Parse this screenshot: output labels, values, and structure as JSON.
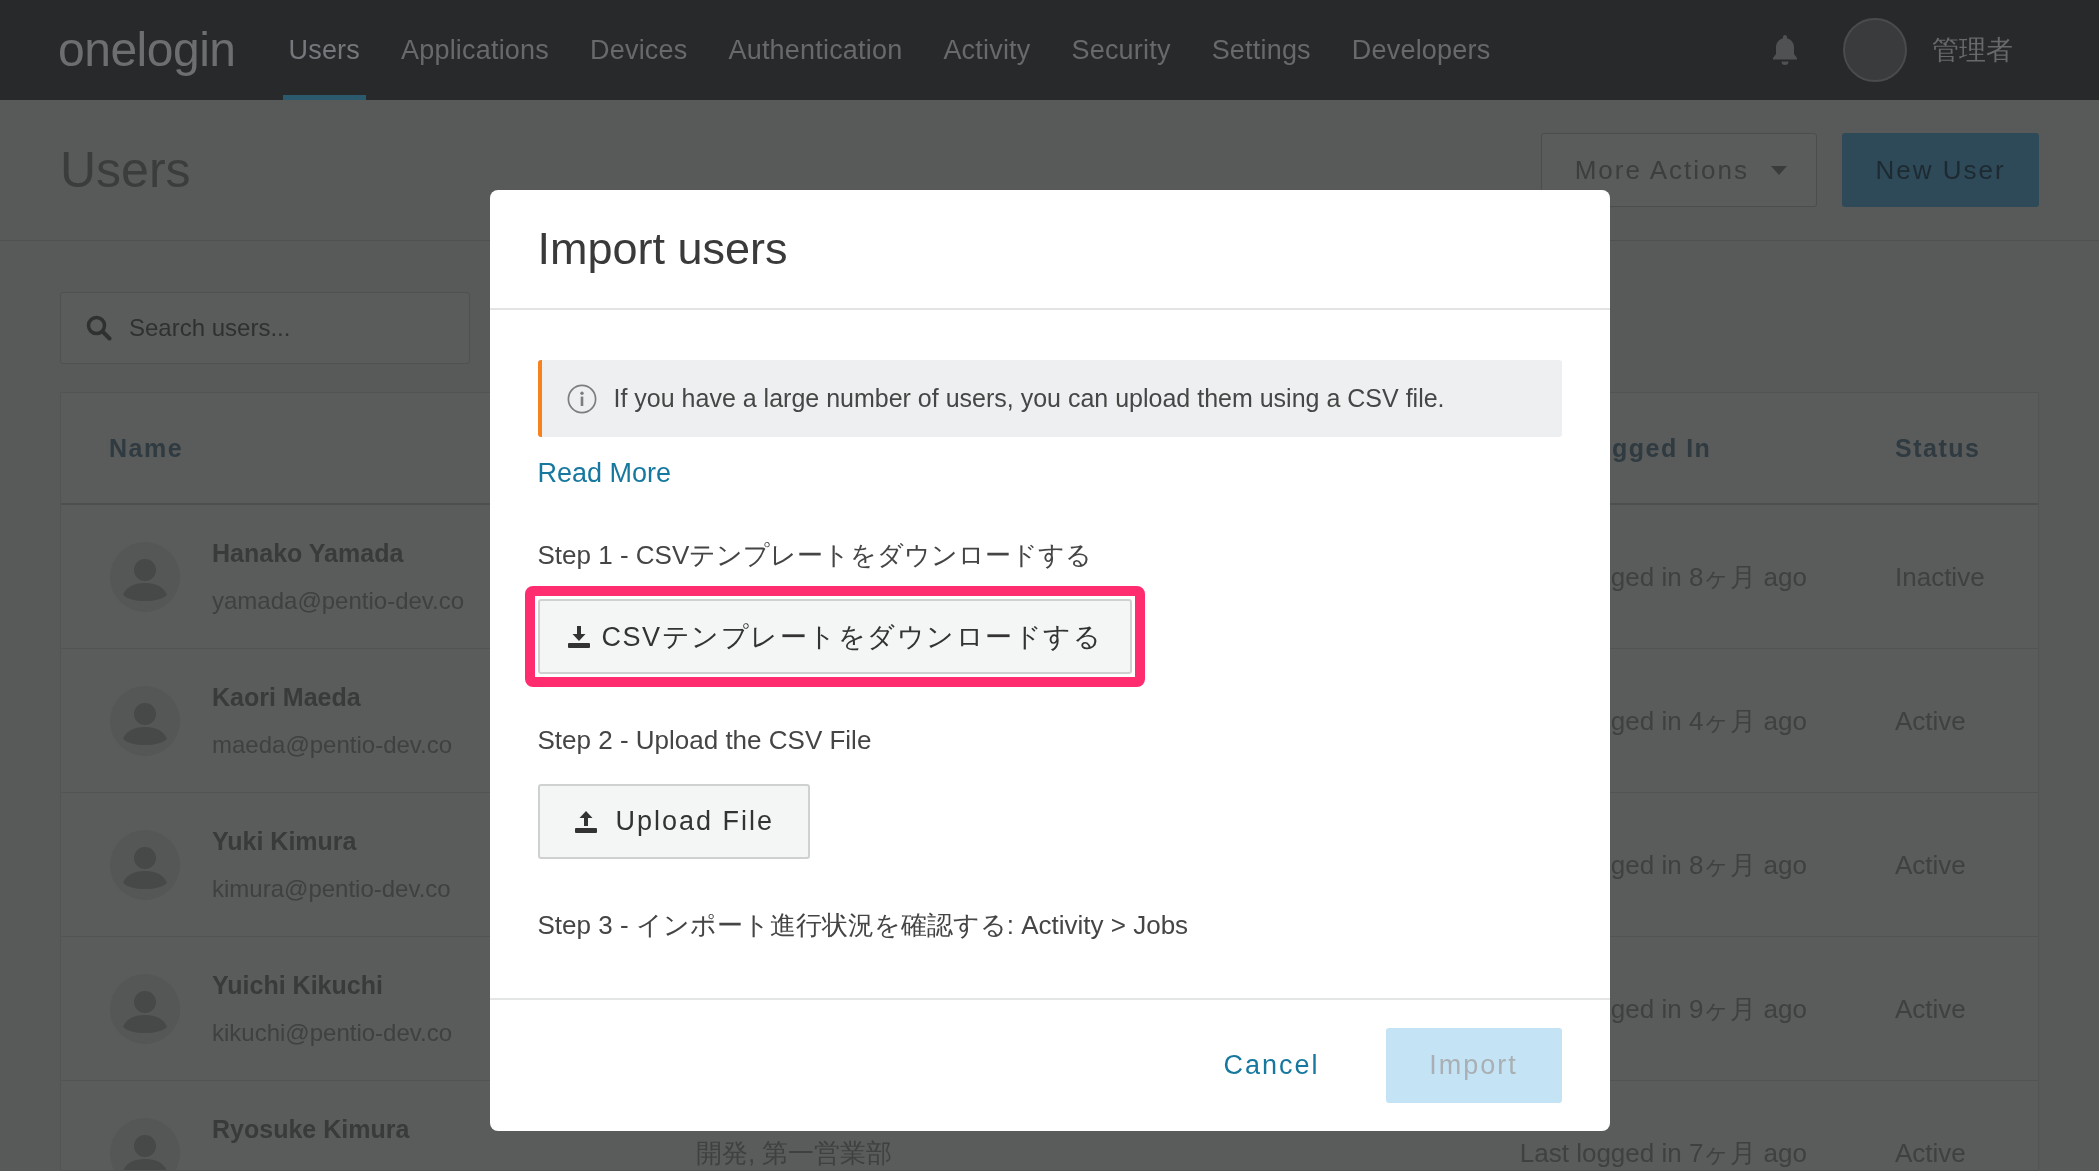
{
  "nav": {
    "logo": "onelogin",
    "items": [
      {
        "label": "Users",
        "selected": true
      },
      {
        "label": "Applications",
        "selected": false
      },
      {
        "label": "Devices",
        "selected": false
      },
      {
        "label": "Authentication",
        "selected": false
      },
      {
        "label": "Activity",
        "selected": false
      },
      {
        "label": "Security",
        "selected": false
      },
      {
        "label": "Settings",
        "selected": false
      },
      {
        "label": "Developers",
        "selected": false
      }
    ],
    "account": {
      "name": "管理者"
    }
  },
  "header": {
    "title": "Users",
    "buttons": [
      {
        "label": "More Actions",
        "kind": "dropdown"
      },
      {
        "label": "New User",
        "kind": "primary"
      }
    ]
  },
  "search": {
    "placeholder": "Search users..."
  },
  "table": {
    "columns": [
      {
        "label": "Name",
        "kind": "name"
      },
      {
        "label": "gged In",
        "kind": "last_login"
      },
      {
        "label": "Status",
        "kind": "status"
      }
    ],
    "rows": [
      {
        "name": "Hanako Yamada",
        "email": "yamada@pentio-dev.co",
        "last_login": "ged in 8ヶ月 ago",
        "status": "Inactive"
      },
      {
        "name": "Kaori Maeda",
        "email": "maeda@pentio-dev.co",
        "last_login": "ged in 4ヶ月 ago",
        "status": "Active"
      },
      {
        "name": "Yuki Kimura",
        "email": "kimura@pentio-dev.co",
        "last_login": "ged in 8ヶ月 ago",
        "status": "Active"
      },
      {
        "name": "Yuichi Kikuchi",
        "email": "kikuchi@pentio-dev.co",
        "last_login": "ged in 9ヶ月 ago",
        "status": "Active"
      },
      {
        "name": "Ryosuke Kimura",
        "department": "開発, 第一営業部",
        "last_login": "Last logged in 7ヶ月 ago",
        "status": "Active"
      }
    ]
  },
  "dialog": {
    "title": "Import users",
    "notice": "If you have a large number of users, you can upload them using a CSV file.",
    "link": "Read More",
    "steps": [
      {
        "label": "Step 1 - CSVテンプレートをダウンロードする",
        "button": {
          "label": "CSVテンプレートをダウンロードする",
          "kind": "download",
          "highlighted": true
        }
      },
      {
        "label": "Step 2 - Upload the CSV File",
        "button": {
          "label": "Upload File",
          "kind": "upload",
          "highlighted": false
        }
      },
      {
        "label": "Step 3 - インポート進行状況を確認する: Activity > Jobs"
      }
    ],
    "buttons": [
      {
        "label": "Cancel",
        "kind": "text",
        "disabled": false
      },
      {
        "label": "Import",
        "kind": "primary",
        "disabled": true
      }
    ]
  }
}
